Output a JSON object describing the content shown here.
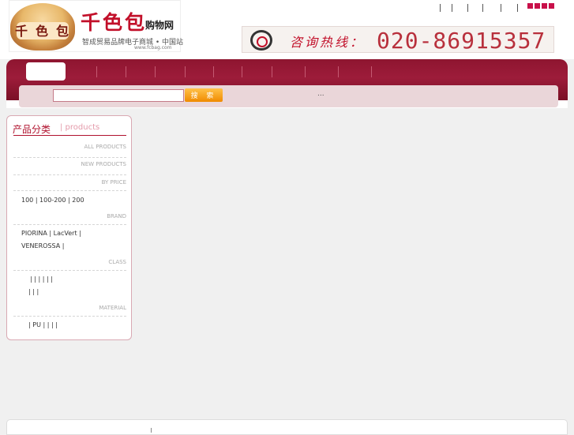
{
  "brand": {
    "logo_chars": [
      "千",
      "色",
      "包"
    ],
    "title": "千色包",
    "subtitle": "购物网",
    "slogan": "智成贸易品牌电子商城 • 中国站",
    "url": "www.fcbag.com"
  },
  "top_links": {
    "separators": [
      "|",
      "|",
      "|",
      "|",
      "|",
      "|"
    ],
    "lang_colors": [
      "#c8104a",
      "#c8104a",
      "#c8104a",
      "#c8104a"
    ]
  },
  "hotline": {
    "label": "咨询热线：",
    "number": "020-86915357"
  },
  "search": {
    "input_value": "",
    "button_label": "搜 索",
    "extra_text": "..."
  },
  "sidebar": {
    "title": "产品分类",
    "title_en": "| products",
    "all_products": "ALL PRODUCTS",
    "new_products": "NEW PRODUCTS",
    "by_price": "BY PRICE",
    "price_links": "100   | 100-200 |  200",
    "brand": "BRAND",
    "brand_line1": "PIORINA |  LacVert |",
    "brand_line2": "VENEROSSA |",
    "class": "CLASS",
    "class_line1": "|     |      |      |      |      |",
    "class_line2": "|     |     |",
    "material": "MATERIAL",
    "material_line": "| PU  |      |      |      |"
  },
  "colors": {
    "accent": "#9d1c3a",
    "search_bg": "#ead6d9",
    "search_button": "#f08a00"
  }
}
